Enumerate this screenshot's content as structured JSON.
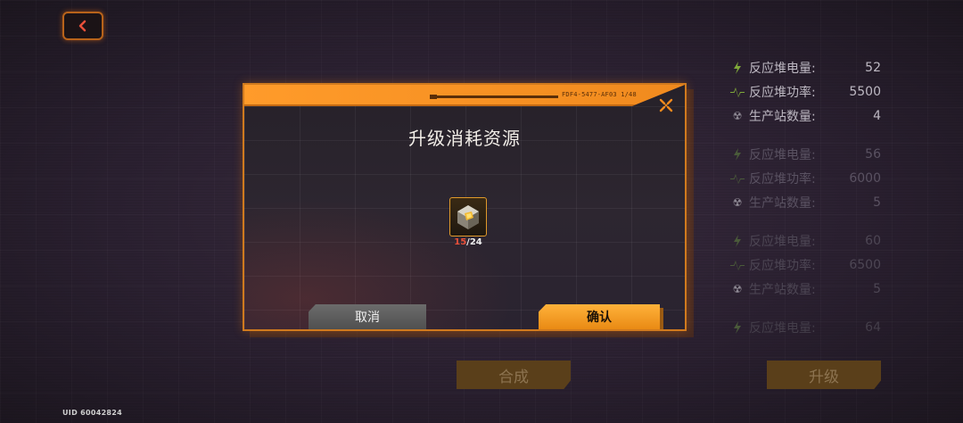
{
  "back_button": {
    "icon": "chevron-left-icon",
    "color": "#e8503a"
  },
  "stats": [
    {
      "label": "反应堆电量:",
      "value": "52"
    },
    {
      "label": "反应堆功率:",
      "value": "5500"
    },
    {
      "label": "生产站数量:",
      "value": "4"
    },
    {
      "label": "反应堆电量:",
      "value": "56"
    },
    {
      "label": "反应堆功率:",
      "value": "6000"
    },
    {
      "label": "生产站数量:",
      "value": "5"
    },
    {
      "label": "反应堆电量:",
      "value": "60"
    },
    {
      "label": "反应堆功率:",
      "value": "6500"
    },
    {
      "label": "生产站数量:",
      "value": "5"
    },
    {
      "label": "反应堆电量:",
      "value": "64"
    }
  ],
  "bottom": {
    "synth_label": "合成",
    "upgrade_label": "升级"
  },
  "uid_text": "UID 60042824",
  "dialog": {
    "header_code": "FDF4-5477-AF03 1/48",
    "title": "升级消耗资源",
    "item": {
      "icon": "crystal-cube-icon",
      "have": "15",
      "separator": "/",
      "need": "24"
    },
    "cancel_label": "取消",
    "confirm_label": "确认"
  },
  "colors": {
    "accent": "#f08a1e",
    "border": "#d07a1e",
    "insufficient": "#e8503a"
  }
}
